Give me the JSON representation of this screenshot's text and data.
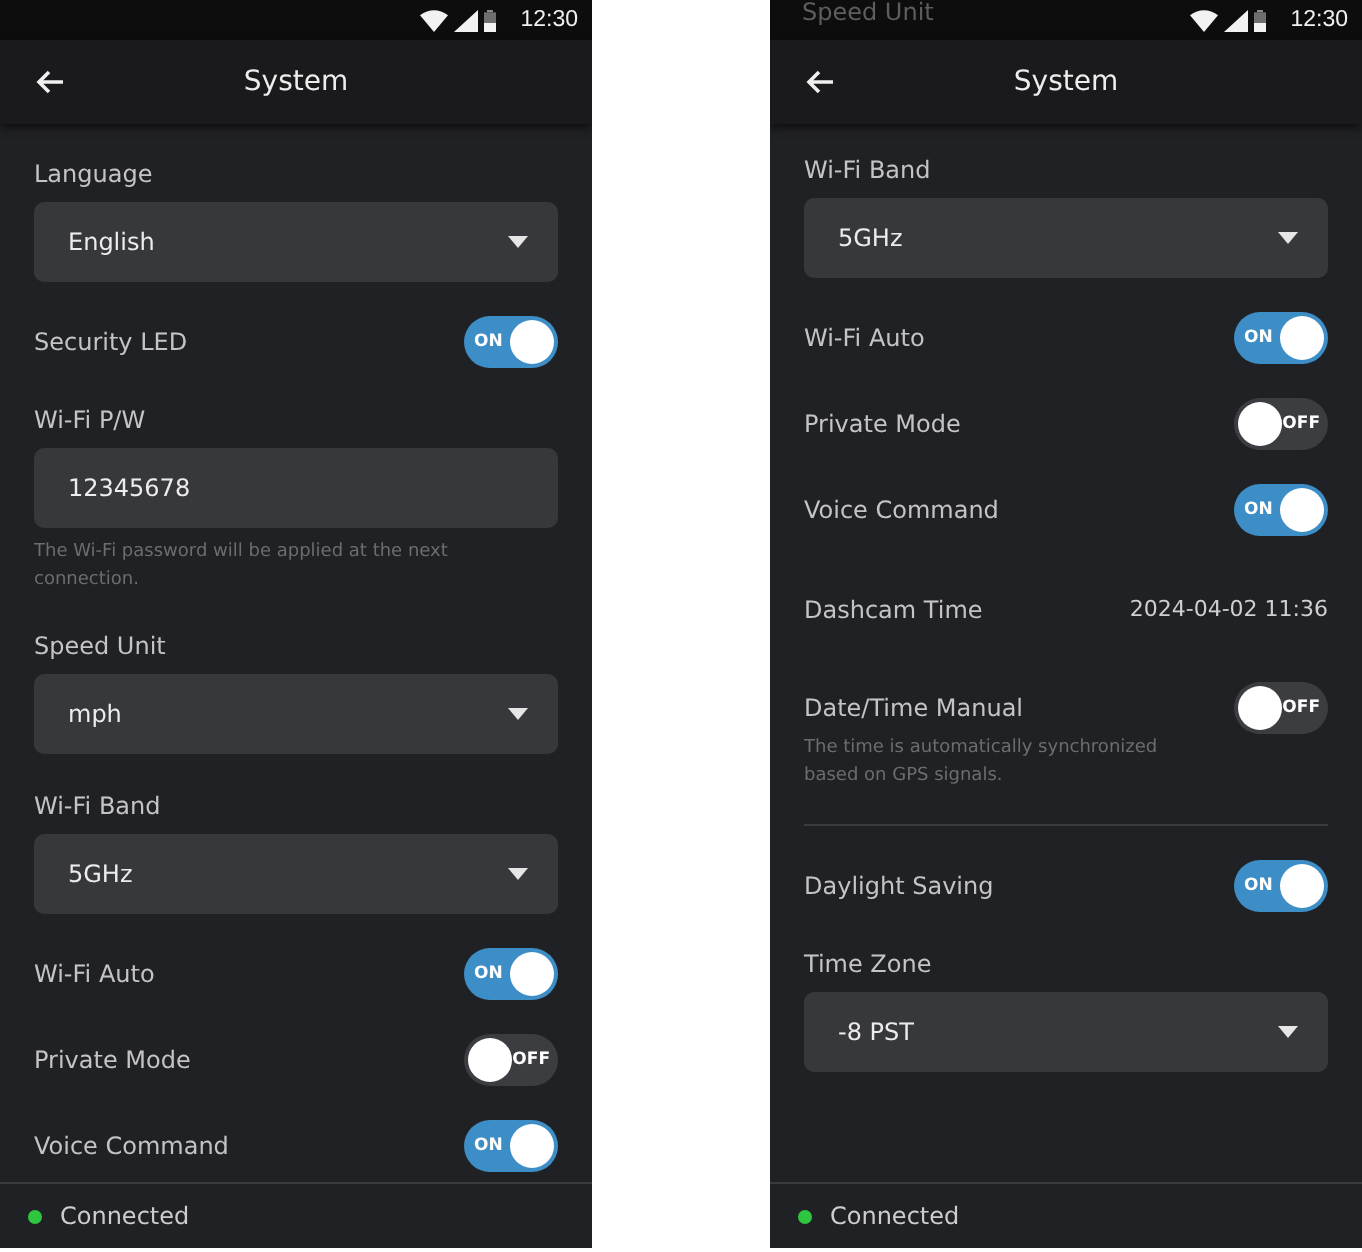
{
  "screens": [
    {
      "status_bar": {
        "time": "12:30"
      },
      "app_bar": {
        "title": "System"
      },
      "settings": [
        {
          "kind": "select",
          "label": "Language",
          "value": "English"
        },
        {
          "kind": "toggle",
          "label": "Security LED",
          "on": true,
          "switch_text": "ON"
        },
        {
          "kind": "input",
          "label": "Wi-Fi P/W",
          "value": "12345678",
          "hint": "The Wi-Fi password will be applied at the next connection."
        },
        {
          "kind": "select",
          "label": "Speed Unit",
          "value": "mph"
        },
        {
          "kind": "select",
          "label": "Wi-Fi Band",
          "value": "5GHz"
        },
        {
          "kind": "toggle",
          "label": "Wi-Fi Auto",
          "on": true,
          "switch_text": "ON"
        },
        {
          "kind": "toggle",
          "label": "Private Mode",
          "on": false,
          "switch_text": "OFF"
        },
        {
          "kind": "toggle",
          "label": "Voice Command",
          "on": true,
          "switch_text": "ON"
        }
      ],
      "footer": {
        "status": "Connected",
        "connected": true
      }
    },
    {
      "status_bar": {
        "peek_text": "Speed Unit",
        "time": "12:30"
      },
      "app_bar": {
        "title": "System"
      },
      "settings": [
        {
          "kind": "select",
          "label": "Wi-Fi Band",
          "value": "5GHz"
        },
        {
          "kind": "toggle",
          "label": "Wi-Fi Auto",
          "on": true,
          "switch_text": "ON"
        },
        {
          "kind": "toggle",
          "label": "Private Mode",
          "on": false,
          "switch_text": "OFF"
        },
        {
          "kind": "toggle",
          "label": "Voice Command",
          "on": true,
          "switch_text": "ON"
        },
        {
          "kind": "info",
          "label": "Dashcam Time",
          "value": "2024-04-02 11:36"
        },
        {
          "kind": "toggle",
          "label": "Date/Time Manual",
          "on": false,
          "switch_text": "OFF",
          "hint": "The time is automatically synchronized based on GPS signals."
        },
        {
          "kind": "divider"
        },
        {
          "kind": "toggle",
          "label": "Daylight Saving",
          "on": true,
          "switch_text": "ON"
        },
        {
          "kind": "select",
          "label": "Time Zone",
          "value": "-8 PST"
        }
      ],
      "footer": {
        "status": "Connected",
        "connected": true
      }
    }
  ]
}
